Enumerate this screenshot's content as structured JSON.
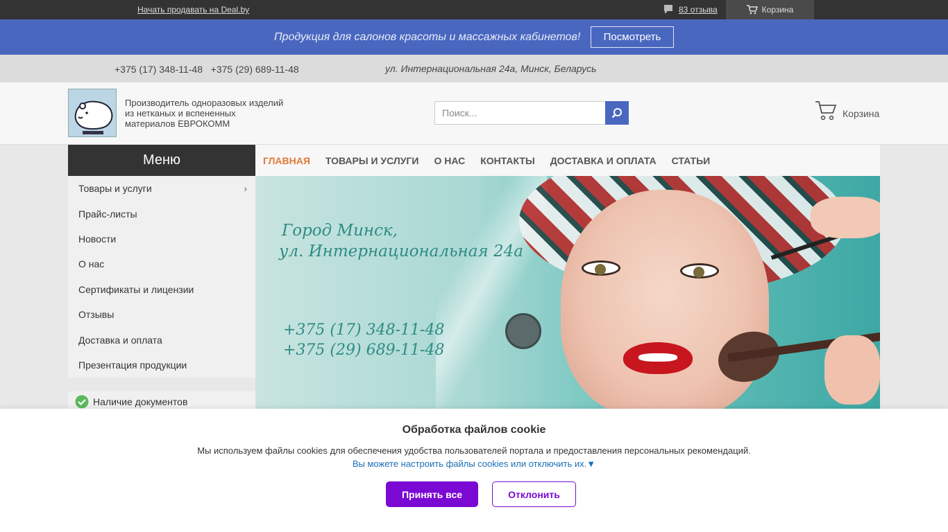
{
  "topbar": {
    "sell_link": "Начать продавать на Deal.by",
    "reviews_link": "83 отзыва",
    "cart_label": "Корзина"
  },
  "promo": {
    "text": "Продукция для салонов красоты и массажных кабинетов!",
    "button": "Посмотреть"
  },
  "contacts": {
    "phones": "+375 (17) 348-11-48   +375 (29) 689-11-48",
    "address": "ул. Интернациональная 24а, Минск, Беларусь"
  },
  "header": {
    "tagline": "Производитель одноразовых изделий из нетканых и вспененных материалов ЕВРОКОММ",
    "search_placeholder": "Поиск...",
    "cart_label": "Корзина"
  },
  "menu": {
    "title": "Меню",
    "items": [
      {
        "label": "Товары и услуги"
      },
      {
        "label": "Прайс-листы"
      },
      {
        "label": "Новости"
      },
      {
        "label": "О нас"
      },
      {
        "label": "Сертификаты и лицензии"
      },
      {
        "label": "Отзывы"
      },
      {
        "label": "Доставка и оплата"
      },
      {
        "label": "Презентация продукции"
      }
    ],
    "docs_label": "Наличие документов"
  },
  "nav": {
    "items": [
      {
        "label": "ГЛАВНАЯ"
      },
      {
        "label": "ТОВАРЫ И УСЛУГИ"
      },
      {
        "label": "О НАС"
      },
      {
        "label": "КОНТАКТЫ"
      },
      {
        "label": "ДОСТАВКА И ОПЛАТА"
      },
      {
        "label": "СТАТЬИ"
      }
    ]
  },
  "banner": {
    "city_line1": "Город Минск,",
    "city_line2": "ул. Интернациональная 24а",
    "phone1": "+375 (17) 348-11-48",
    "phone2": "+375 (29) 689-11-48"
  },
  "cookie": {
    "title": "Обработка файлов cookie",
    "text": "Мы используем файлы cookies для обеспечения удобства пользователей портала и предоставления персональных рекомендаций.",
    "settings_link": "Вы можете настроить файлы cookies или отключить их.▼",
    "accept": "Принять все",
    "decline": "Отклонить"
  },
  "colors": {
    "topbar": "#333333",
    "promo": "#4a67c0",
    "accent_nav": "#e07a3a",
    "cookie_button": "#7b09d4",
    "banner_text": "#2f8b84"
  },
  "icons": [
    "comment-icon",
    "cart-icon",
    "search-icon",
    "check-icon",
    "chevron-right-icon",
    "logo-bear"
  ]
}
